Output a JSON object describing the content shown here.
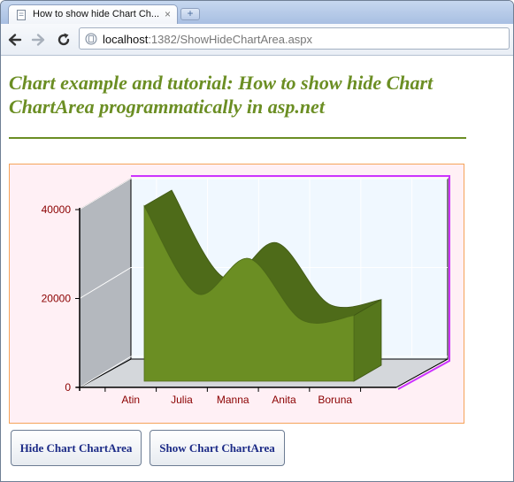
{
  "browser": {
    "tab_title": "How to show hide Chart Ch...",
    "tab_close": "×",
    "new_tab": "+",
    "url_host": "localhost",
    "url_rest": ":1382/ShowHideChartArea.aspx",
    "icons": [
      "page-favicon",
      "back-arrow",
      "forward-arrow",
      "reload",
      "page-document"
    ]
  },
  "page": {
    "heading": "Chart example and tutorial: How to show hide Chart ChartArea programmatically in asp.net"
  },
  "buttons": {
    "hide_label": "Hide Chart ChartArea",
    "show_label": "Show Chart ChartArea"
  },
  "colors": {
    "heading": "#6b8e23",
    "series": "#6b8e23",
    "chart_background": "#fff0f5",
    "plot_background": "#f0f8ff",
    "axis_labels": "#8b0000",
    "chart_border": "#f5a35a",
    "button_text": "#1b2a86"
  },
  "chart_data": {
    "type": "area",
    "style": "3d",
    "categories": [
      "Atin",
      "Julia",
      "Manna",
      "Anita",
      "Boruna"
    ],
    "series": [
      {
        "values": [
          40000,
          20000,
          28000,
          14000,
          15000
        ]
      }
    ],
    "y_ticks": [
      "0",
      "20000",
      "40000"
    ],
    "ylim": [
      0,
      40000
    ],
    "grid": true,
    "legend": "none"
  }
}
